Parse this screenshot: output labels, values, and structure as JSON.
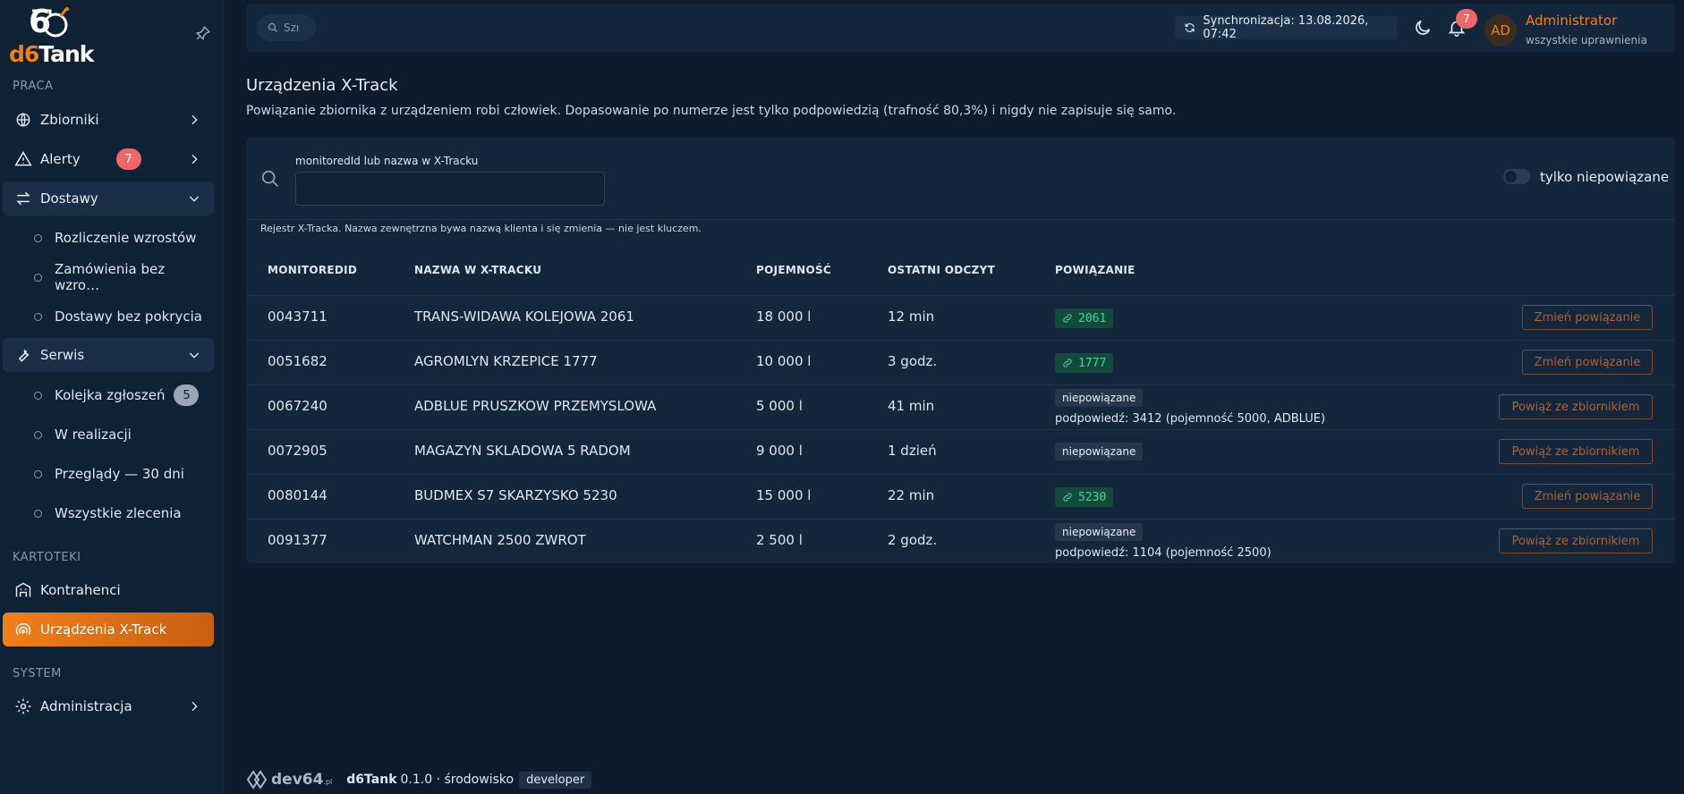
{
  "brand": {
    "logo_mark": "6",
    "logo_d6": "d6",
    "logo_tank": "Tank"
  },
  "sidebar": {
    "sections": {
      "praca": "PRACA",
      "kartoteki": "KARTOTEKI",
      "system": "SYSTEM"
    },
    "items": {
      "zbiorniki": "Zbiorniki",
      "alerty": "Alerty",
      "alerty_badge": "7",
      "dostawy": "Dostawy",
      "rozliczenie": "Rozliczenie wzrostów",
      "zamowienia": "Zamówienia bez wzro…",
      "dostawy_bez": "Dostawy bez pokrycia",
      "serwis": "Serwis",
      "kolejka": "Kolejka zgłoszeń",
      "kolejka_badge": "5",
      "w_realizacji": "W realizacji",
      "przeglady": "Przeglądy — 30 dni",
      "wszystkie": "Wszystkie zlecenia",
      "kontrahenci": "Kontrahenci",
      "urzadzenia": "Urządzenia X-Track",
      "administracja": "Administracja"
    }
  },
  "topbar": {
    "search_placeholder": "Szı",
    "sync": "Synchronizacja: 13.08.2026, 07:42",
    "notifications": "7",
    "avatar": "AD",
    "user_name": "Administrator",
    "user_role": "wszystkie uprawnienia"
  },
  "page": {
    "title": "Urządzenia X-Track",
    "subtitle": "Powiązanie zbiornika z urządzeniem robi człowiek. Dopasowanie po numerze jest tylko podpowiedzią (trafność 80,3%) i nigdy nie zapisuje się samo."
  },
  "filter": {
    "label": "monitoredId lub nazwa w X-Tracku",
    "value": "",
    "toggle_label": "tylko niepowiązane",
    "note": "Rejestr X-Tracka. Nazwa zewnętrzna bywa nazwą klienta i się zmienia — nie jest kluczem."
  },
  "table": {
    "headers": [
      "MONITOREDID",
      "NAZWA W X-TRACKU",
      "POJEMNOŚĆ",
      "OSTATNI ODCZYT",
      "POWIĄZANIE"
    ],
    "rows": [
      {
        "id": "0043711",
        "name": "TRANS-WIDAWA KOLEJOWA 2061",
        "capacity": "18 000 l",
        "last": "12 min",
        "link": "2061",
        "unlinked": "",
        "hint": "",
        "action": "Zmień powiązanie"
      },
      {
        "id": "0051682",
        "name": "AGROMLYN KRZEPICE 1777",
        "capacity": "10 000 l",
        "last": "3 godz.",
        "link": "1777",
        "unlinked": "",
        "hint": "",
        "action": "Zmień powiązanie"
      },
      {
        "id": "0067240",
        "name": "ADBLUE PRUSZKOW PRZEMYSLOWA",
        "capacity": "5 000 l",
        "last": "41 min",
        "link": "",
        "unlinked": "niepowiązane",
        "hint": "podpowiedź: 3412 (pojemność 5000, ADBLUE)",
        "action": "Powiąż ze zbiornikiem"
      },
      {
        "id": "0072905",
        "name": "MAGAZYN SKLADOWA 5 RADOM",
        "capacity": "9 000 l",
        "last": "1 dzień",
        "link": "",
        "unlinked": "niepowiązane",
        "hint": "",
        "action": "Powiąż ze zbiornikiem"
      },
      {
        "id": "0080144",
        "name": "BUDMEX S7 SKARZYSKO 5230",
        "capacity": "15 000 l",
        "last": "22 min",
        "link": "5230",
        "unlinked": "",
        "hint": "",
        "action": "Zmień powiązanie"
      },
      {
        "id": "0091377",
        "name": "WATCHMAN 2500 ZWROT",
        "capacity": "2 500 l",
        "last": "2 godz.",
        "link": "",
        "unlinked": "niepowiązane",
        "hint": "podpowiedź: 1104 (pojemność 2500)",
        "action": "Powiąż ze zbiornikiem"
      }
    ]
  },
  "footer": {
    "dev_brand": "dev64",
    "dev_suffix": ".pl",
    "product": "d6Tank",
    "version": "0.1.0 · środowisko",
    "env": "developer"
  },
  "colors": {
    "accent": "#f07f1a",
    "link_green": "#45d39a",
    "badge_red": "#f0676a"
  }
}
